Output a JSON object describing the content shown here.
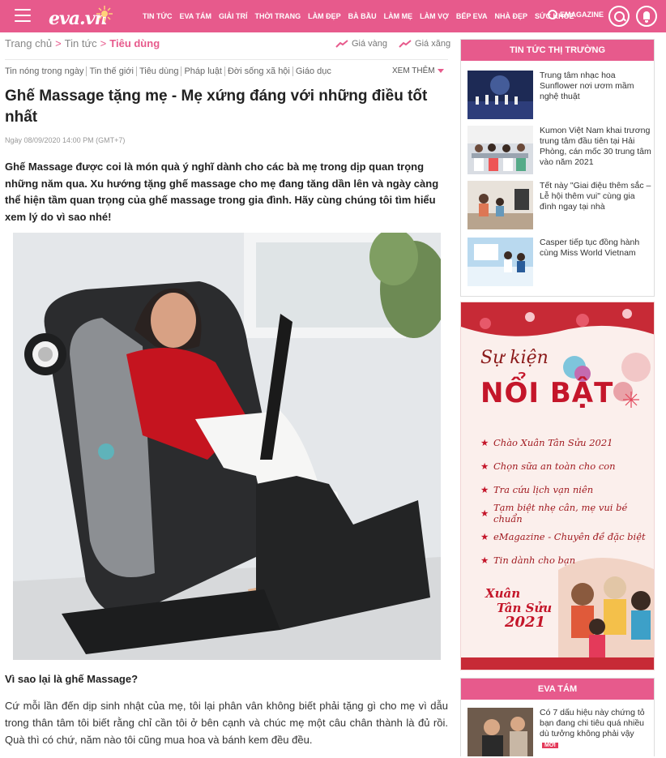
{
  "header": {
    "logo": "eva.vn",
    "nav": [
      "TIN TỨC",
      "EVA TÁM",
      "GIẢI TRÍ",
      "THỜI TRANG",
      "LÀM ĐẸP",
      "BÀ BẦU",
      "LÀM MẸ",
      "LÀM VỢ",
      "BẾP EVA",
      "NHÀ ĐẸP",
      "SỨC KHỎE"
    ],
    "emagazine": "EMAGAZINE"
  },
  "breadcrumb": {
    "home": "Trang chủ",
    "sep1": ">",
    "news": "Tin tức",
    "sep2": ">",
    "current": "Tiêu dùng"
  },
  "prices": {
    "gold": "Giá vàng",
    "gas": "Giá xăng"
  },
  "subnav": [
    "Tin nóng trong ngày",
    "Tin thế giới",
    "Tiêu dùng",
    "Pháp luật",
    "Đời sống xã hội",
    "Giáo dục"
  ],
  "more": "XEM THÊM",
  "article": {
    "title": "Ghế Massage tặng mẹ - Mẹ xứng đáng với những điều tốt nhất",
    "date": "Ngày 08/09/2020 14:00 PM (GMT+7)",
    "lead": "Ghế Massage được coi là món quà ý nghĩ dành cho các bà mẹ trong dịp quan trọng những năm qua. Xu hướng tặng ghế massage cho mẹ đang tăng dần lên và ngày càng thể hiện tầm quan trọng của ghế massage trong gia đình. Hãy cùng chúng tôi tìm hiểu xem lý do vì sao nhé!",
    "subheading": "Vì sao lại là ghế Massage?",
    "body": "Cứ mỗi lần đến dịp sinh nhật của mẹ, tôi lại phân vân không biết phải tặng gì cho mẹ vì dẫu trong thân tâm tôi biết rằng chỉ cần tôi ở bên cạnh và chúc mẹ một câu chân thành là đủ rồi. Quà thì có chứ, năm nào tôi cũng mua hoa và bánh kem đều đều."
  },
  "market": {
    "heading": "TIN TỨC THỊ TRƯỜNG",
    "items": [
      {
        "text": "Trung tâm nhạc hoa Sunflower nơi ươm mầm nghệ thuật"
      },
      {
        "text": "Kumon Việt Nam khai trương trung tâm đầu tiên tại Hải Phòng, cán mốc 30 trung tâm vào năm 2021"
      },
      {
        "text": "Tết này \"Giai điệu thêm sắc – Lễ hội thêm vui\" cùng gia đình ngay tại nhà"
      },
      {
        "text": "Casper tiếp tục đồng hành cùng Miss World Vietnam"
      }
    ]
  },
  "banner": {
    "su_kien": "Sự kiện",
    "noi_bat": "NỔI BẬT",
    "items": [
      "Chào Xuân Tân Sửu 2021",
      "Chọn sữa an toàn cho con",
      "Tra cứu lịch vạn niên",
      "Tạm biệt nhẹ cân, mẹ vui bé chuẩn",
      "eMagazine - Chuyên đề đặc biệt",
      "Tin dành cho bạn"
    ],
    "xuan": "Xuân",
    "tan_suu": "Tân Sửu",
    "year": "2021"
  },
  "eva_tam": {
    "heading": "EVA TÁM",
    "item": "Có 7 dấu hiệu này chứng tỏ bạn đang chi tiêu quá nhiều dù tưởng không phải vậy",
    "badge": "MỚI"
  }
}
